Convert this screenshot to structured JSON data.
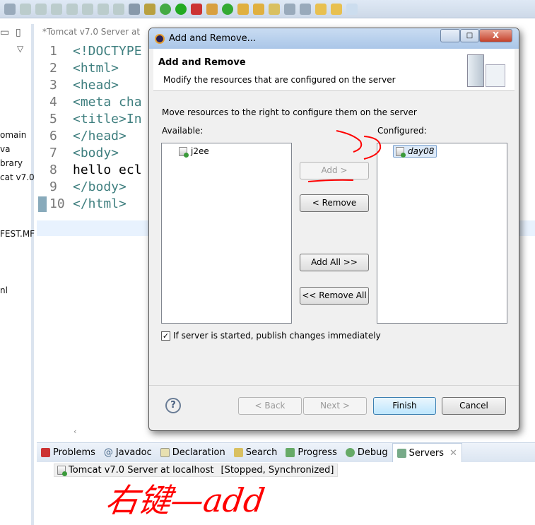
{
  "editor": {
    "tab_title": "*Tomcat v7.0 Server at",
    "lines": [
      {
        "n": "1",
        "code": "<!DOCTYPE"
      },
      {
        "n": "2",
        "code": "<html>"
      },
      {
        "n": "3",
        "code": "<head>"
      },
      {
        "n": "4",
        "code": "<meta cha"
      },
      {
        "n": "5",
        "code": "<title>In"
      },
      {
        "n": "6",
        "code": "</head>"
      },
      {
        "n": "7",
        "code": "<body>"
      },
      {
        "n": "8",
        "code": "hello ecl"
      },
      {
        "n": "9",
        "code": "</body>"
      },
      {
        "n": "10",
        "code": "</html>"
      }
    ]
  },
  "left_pane": {
    "items": [
      "omain",
      "va",
      "brary",
      "cat v7.0",
      "",
      "FEST.MF",
      "nl"
    ]
  },
  "dialog": {
    "title": "Add and Remove...",
    "header_title": "Add and Remove",
    "header_desc": "Modify the resources that are configured on the server",
    "instruction": "Move resources to the right to configure them on the server",
    "available_label": "Available:",
    "configured_label": "Configured:",
    "available_items": [
      "j2ee"
    ],
    "configured_items": [
      "day08"
    ],
    "buttons": {
      "add": "Add >",
      "remove": "< Remove",
      "add_all": "Add All >>",
      "remove_all": "<< Remove All"
    },
    "publish_checkbox": {
      "label": "If server is started, publish changes immediately",
      "checked": true
    },
    "footer": {
      "back": "< Back",
      "next": "Next >",
      "finish": "Finish",
      "cancel": "Cancel"
    },
    "close_glyph": "X"
  },
  "bottom_panel": {
    "tabs": [
      "Problems",
      "Javadoc",
      "Declaration",
      "Search",
      "Progress",
      "Debug",
      "Servers"
    ],
    "active_tab": "Servers",
    "server": {
      "name": "Tomcat v7.0 Server at localhost",
      "status": "[Stopped, Synchronized]"
    }
  },
  "annotation": {
    "text": "右键—add",
    "color": "#ff0000"
  }
}
